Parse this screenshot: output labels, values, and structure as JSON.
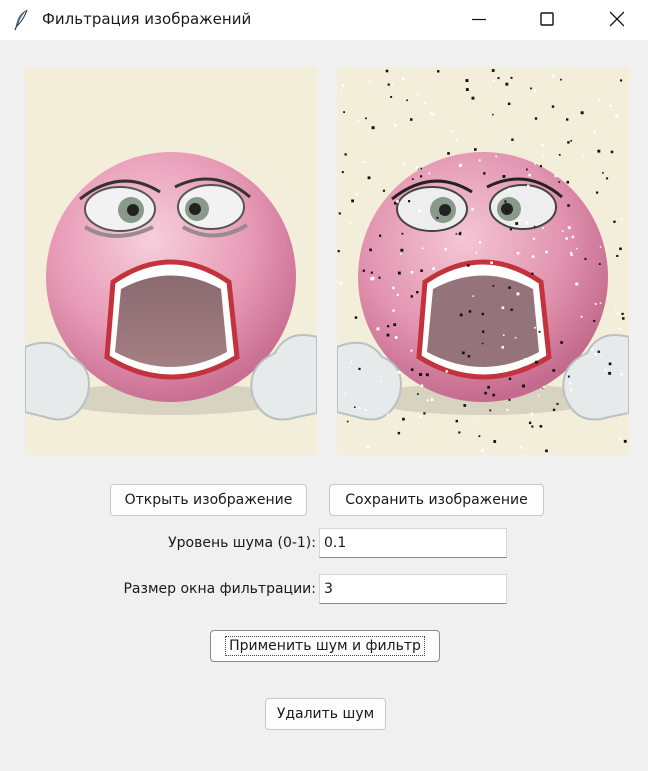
{
  "window": {
    "title": "Фильтрация изображений"
  },
  "icons": {
    "app": "feather-icon",
    "minimize": "minimize-icon",
    "maximize": "maximize-icon",
    "close": "close-icon"
  },
  "images": {
    "original": "emoji-original-image",
    "filtered": "emoji-noisy-image"
  },
  "buttons": {
    "open": "Открыть изображение",
    "save": "Сохранить изображение",
    "apply": "Применить шум и фильтр",
    "remove": "Удалить шум"
  },
  "fields": {
    "noise_label": "Уровень шума (0-1):",
    "noise_value": "0.1",
    "window_label": "Размер окна фильтрации:",
    "window_value": "3"
  }
}
